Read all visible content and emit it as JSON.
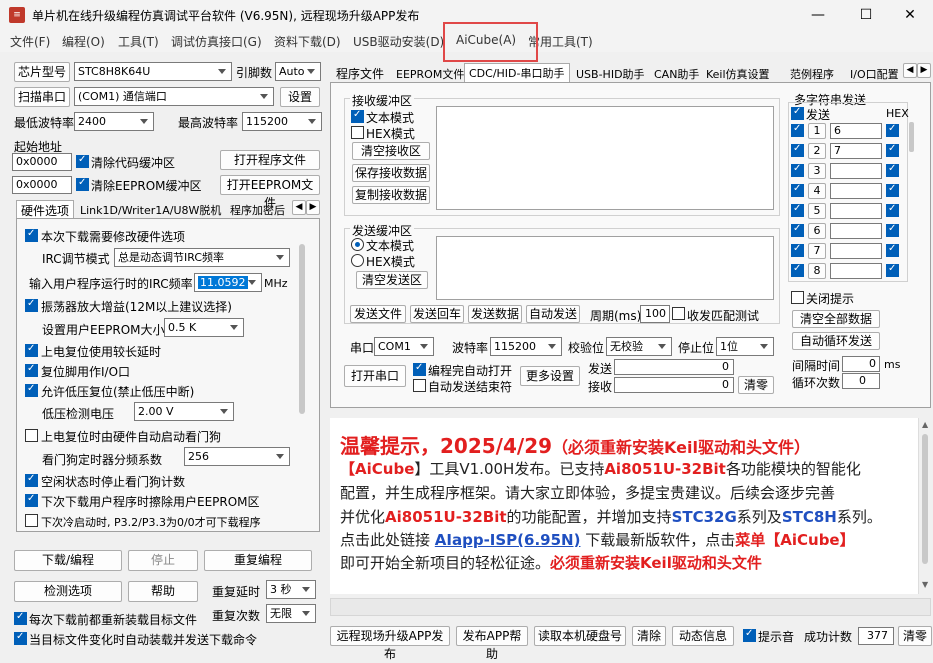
{
  "window": {
    "title": "单片机在线升级编程仿真调试平台软件 (V6.95N), 远程现场升级APP发布",
    "min": "—",
    "max": "☐",
    "close": "✕"
  },
  "menu": [
    "文件(F)",
    "编程(O)",
    "工具(T)",
    "调试仿真接口(G)",
    "资料下载(D)",
    "USB驱动安装(D)",
    "AiCube(A)",
    "常用工具(T)"
  ],
  "left": {
    "chip_btn": "芯片型号",
    "chip_value": "STC8H8K64U",
    "pin_label": "引脚数",
    "pin_value": "Auto",
    "scan_btn": "扫描串口",
    "port_value": "(COM1) 通信端口",
    "settings_btn": "设置",
    "min_baud_label": "最低波特率",
    "min_baud": "2400",
    "max_baud_label": "最高波特率",
    "max_baud": "115200",
    "start_addr_label": "起始地址",
    "addr1": "0x0000",
    "clear_code": "清除代码缓冲区",
    "open_prog": "打开程序文件",
    "addr2": "0x0000",
    "clear_eeprom": "清除EEPROM缓冲区",
    "open_eeprom": "打开EEPROM文件",
    "tabs": [
      "硬件选项",
      "Link1D/Writer1A/U8W脱机",
      "程序加密后"
    ],
    "options": {
      "o1": "本次下载需要修改硬件选项",
      "irc_mode_label": "IRC调节模式",
      "irc_mode": "总是动态调节IRC频率",
      "irc_freq_label": "输入用户程序运行时的IRC频率",
      "irc_freq": "11.0592",
      "mhz": "MHz",
      "o2": "振荡器放大增益(12M以上建议选择)",
      "eeprom_size_label": "设置用户EEPROM大小",
      "eeprom_size": "0.5 K",
      "o3": "上电复位使用较长延时",
      "o4": "复位脚用作I/O口",
      "o5": "允许低压复位(禁止低压中断)",
      "lv_label": "低压检测电压",
      "lv_value": "2.00 V",
      "o6": "上电复位时由硬件自动启动看门狗",
      "wd_label": "看门狗定时器分频系数",
      "wd_value": "256",
      "o7": "空闲状态时停止看门狗计数",
      "o8": "下次下载用户程序时擦除用户EEPROM区",
      "o9": "下次冷启动时, P3.2/P3.3为0/0才可下载程序"
    },
    "download_btn": "下载/编程",
    "stop_btn": "停止",
    "reprogram_btn": "重复编程",
    "detect_btn": "检测选项",
    "help_btn": "帮助",
    "repeat_delay_label": "重复延时",
    "repeat_delay": "3 秒",
    "reload_label": "每次下载前都重新装载目标文件",
    "repeat_count_label": "重复次数",
    "repeat_count": "无限",
    "auto_label": "当目标文件变化时自动装载并发送下载命令"
  },
  "right_tabs": [
    "程序文件",
    "EEPROM文件",
    "CDC/HID-串口助手",
    "USB-HID助手",
    "CAN助手",
    "Keil仿真设置",
    "范例程序",
    "I/O口配置"
  ],
  "serial": {
    "recv_title": "接收缓冲区",
    "text_mode": "文本模式",
    "hex_mode": "HEX模式",
    "clear_recv": "清空接收区",
    "save_recv": "保存接收数据",
    "copy_recv": "复制接收数据",
    "send_title": "发送缓冲区",
    "s_text_mode": "文本模式",
    "s_hex_mode": "HEX模式",
    "clear_send": "清空发送区",
    "send_file": "发送文件",
    "send_back": "发送回车",
    "send_data": "发送数据",
    "auto_send": "自动发送",
    "period_label": "周期(ms)",
    "period": "100",
    "match_label": "收发匹配测试",
    "port_label": "串口",
    "port": "COM1",
    "baud_label": "波特率",
    "baud": "115200",
    "parity_label": "校验位",
    "parity": "无校验",
    "stop_label": "停止位",
    "stop": "1位",
    "open_port": "打开串口",
    "auto_open": "编程完自动打开",
    "auto_end": "自动发送结束符",
    "more": "更多设置",
    "sent_label": "发送",
    "sent": "0",
    "recv_label": "接收",
    "recv": "0",
    "zero_btn": "清零"
  },
  "multi": {
    "title": "多字符串发送",
    "send": "发送",
    "hex": "HEX",
    "rows": [
      {
        "n": "1",
        "v": "6"
      },
      {
        "n": "2",
        "v": "7"
      },
      {
        "n": "3",
        "v": ""
      },
      {
        "n": "4",
        "v": ""
      },
      {
        "n": "5",
        "v": ""
      },
      {
        "n": "6",
        "v": ""
      },
      {
        "n": "7",
        "v": ""
      },
      {
        "n": "8",
        "v": ""
      }
    ],
    "close_tip": "关闭提示",
    "clear_all": "清空全部数据",
    "auto_loop": "自动循环发送",
    "interval_label": "间隔时间",
    "interval": "0",
    "ms": "ms",
    "loop_label": "循环次数",
    "loop": "0"
  },
  "notice": {
    "l1": "温馨提示，2025/4/29",
    "l1b": "（必须重新安装Keil驱动和头文件）",
    "l2a": "【",
    "l2b": "AiCube",
    "l2c": "】工具V1.00H发布。已支持",
    "l2d": "Ai8051U-32Bit",
    "l2e": "各功能模块的智能化",
    "l3": "配置，并生成程序框架。请大家立即体验，多提宝贵建议。后续会逐步完善",
    "l4a": "并优化",
    "l4b": "Ai8051U-32Bit",
    "l4c": "的功能配置，并增加支持",
    "l4d": "STC32G",
    "l4e": "系列及",
    "l4f": "STC8H",
    "l4g": "系列。",
    "l5a": "点击此处链接 ",
    "l5b": "AIapp-ISP(6.95N)",
    "l5c": " 下载最新版软件，点击",
    "l5d": "菜单【",
    "l5e": "AiCube",
    "l5f": "】",
    "l6a": "即可开始全新项目的轻松征途。",
    "l6b": "必须重新安装Keil驱动和头文件"
  },
  "bottom": {
    "b1": "远程现场升级APP发布",
    "b2": "发布APP帮助",
    "b3": "读取本机硬盘号",
    "b4": "清除",
    "b5": "动态信息",
    "sound": "提示音",
    "count_label": "成功计数",
    "count": "377",
    "zero": "清零"
  }
}
